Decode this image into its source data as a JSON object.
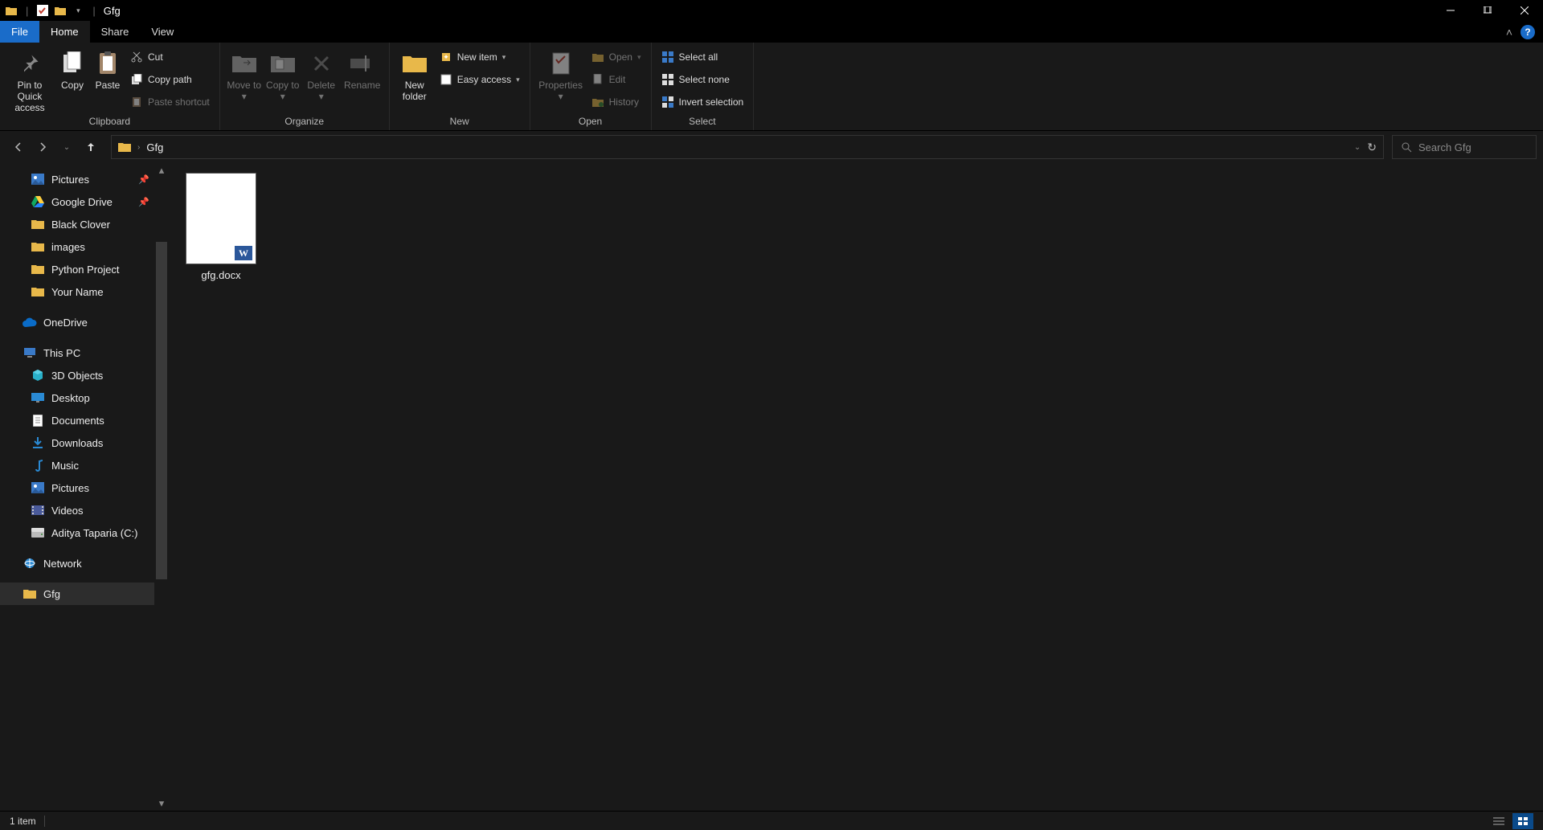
{
  "window": {
    "title": "Gfg"
  },
  "menutabs": {
    "file": "File",
    "home": "Home",
    "share": "Share",
    "view": "View"
  },
  "ribbon": {
    "clipboard": {
      "label": "Clipboard",
      "pin": "Pin to Quick access",
      "copy": "Copy",
      "paste": "Paste",
      "cut": "Cut",
      "copy_path": "Copy path",
      "paste_shortcut": "Paste shortcut"
    },
    "organize": {
      "label": "Organize",
      "move_to": "Move to",
      "copy_to": "Copy to",
      "delete": "Delete",
      "rename": "Rename"
    },
    "new": {
      "label": "New",
      "new_folder": "New folder",
      "new_item": "New item",
      "easy_access": "Easy access"
    },
    "open": {
      "label": "Open",
      "properties": "Properties",
      "open": "Open",
      "edit": "Edit",
      "history": "History"
    },
    "select": {
      "label": "Select",
      "select_all": "Select all",
      "select_none": "Select none",
      "invert": "Invert selection"
    }
  },
  "address": {
    "crumb0": "Gfg"
  },
  "search": {
    "placeholder": "Search Gfg"
  },
  "sidebar": {
    "items": [
      {
        "label": "Pictures",
        "icon": "picture",
        "pinned": true,
        "root": false
      },
      {
        "label": "Google Drive",
        "icon": "gdrive",
        "pinned": true,
        "root": false
      },
      {
        "label": "Black Clover",
        "icon": "folder",
        "pinned": false,
        "root": false
      },
      {
        "label": "images",
        "icon": "folder",
        "pinned": false,
        "root": false
      },
      {
        "label": "Python Project",
        "icon": "folder",
        "pinned": false,
        "root": false
      },
      {
        "label": "Your Name",
        "icon": "folder",
        "pinned": false,
        "root": false
      }
    ],
    "onedrive": "OneDrive",
    "thispc": "This PC",
    "thispc_items": [
      {
        "label": "3D Objects",
        "icon": "cube"
      },
      {
        "label": "Desktop",
        "icon": "desktop"
      },
      {
        "label": "Documents",
        "icon": "doc"
      },
      {
        "label": "Downloads",
        "icon": "download"
      },
      {
        "label": "Music",
        "icon": "music"
      },
      {
        "label": "Pictures",
        "icon": "picture"
      },
      {
        "label": "Videos",
        "icon": "video"
      },
      {
        "label": "Aditya Taparia (C:)",
        "icon": "drive"
      }
    ],
    "network": "Network",
    "current": "Gfg"
  },
  "files": [
    {
      "name": "gfg.docx",
      "type": "docx"
    }
  ],
  "status": {
    "count": "1 item"
  }
}
